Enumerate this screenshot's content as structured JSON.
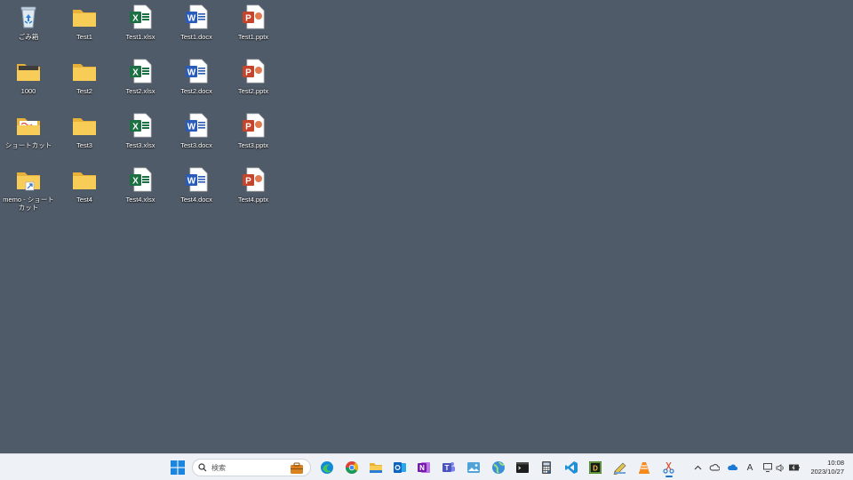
{
  "desktop": {
    "icons": [
      {
        "label": "ごみ箱",
        "type": "recycle-bin"
      },
      {
        "label": "Test1",
        "type": "folder"
      },
      {
        "label": "Test1.xlsx",
        "type": "excel"
      },
      {
        "label": "Test1.docx",
        "type": "word"
      },
      {
        "label": "Test1.pptx",
        "type": "powerpoint"
      },
      {
        "label": "1000",
        "type": "folder-dark"
      },
      {
        "label": "Test2",
        "type": "folder"
      },
      {
        "label": "Test2.xlsx",
        "type": "excel"
      },
      {
        "label": "Test2.docx",
        "type": "word"
      },
      {
        "label": "Test2.pptx",
        "type": "powerpoint"
      },
      {
        "label": "ショートカット",
        "type": "folder-shortcut"
      },
      {
        "label": "Test3",
        "type": "folder"
      },
      {
        "label": "Test3.xlsx",
        "type": "excel"
      },
      {
        "label": "Test3.docx",
        "type": "word"
      },
      {
        "label": "Test3.pptx",
        "type": "powerpoint"
      },
      {
        "label": "memo - ショートカット",
        "type": "folder-link"
      },
      {
        "label": "Test4",
        "type": "folder"
      },
      {
        "label": "Test4.xlsx",
        "type": "excel"
      },
      {
        "label": "Test4.docx",
        "type": "word"
      },
      {
        "label": "Test4.pptx",
        "type": "powerpoint"
      }
    ]
  },
  "taskbar": {
    "search_placeholder": "検索",
    "pinned": [
      "start-icon",
      "work-bag-icon",
      "edge-icon",
      "chrome-icon",
      "file-explorer-icon",
      "outlook-icon",
      "onenote-icon",
      "teams-icon",
      "photos-icon",
      "globe-icon",
      "terminal-icon",
      "calculator-icon",
      "vscode-icon",
      "app-icon",
      "pen-icon",
      "vlc-icon",
      "snipping-tool-icon"
    ],
    "ime_indicator": "A",
    "clock": {
      "time": "10:08",
      "date": "2023/10/27"
    }
  },
  "colors": {
    "desktop_bg": "#505b69",
    "taskbar_bg": "#eef1f5",
    "folder": "#f6c84e",
    "excel": "#1d7044",
    "word": "#2b5bb8",
    "powerpoint": "#c4452c"
  }
}
